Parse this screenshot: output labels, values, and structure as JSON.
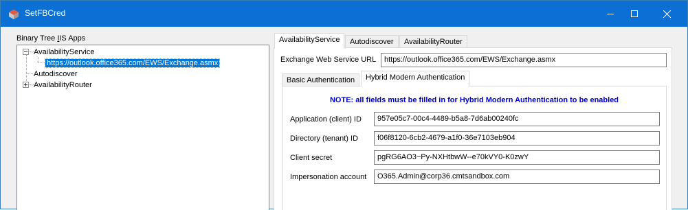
{
  "window": {
    "title": "SetFBCred",
    "accent": "#0b6fd3",
    "controls": {
      "minimize": "minimize-icon",
      "maximize": "maximize-icon",
      "close": "close-icon"
    }
  },
  "tree": {
    "label_prefix": "Binary Tree ",
    "label_mnemonic": "I",
    "label_suffix": "IS Apps",
    "nodes": [
      {
        "label": "AvailabilityService",
        "expanded": true
      },
      {
        "label": "https://outlook.office365.com/EWS/Exchange.asmx",
        "selected": true
      },
      {
        "label": "Autodiscover"
      },
      {
        "label": "AvailabilityRouter",
        "expanded": false
      }
    ]
  },
  "tabs": [
    {
      "label": "AvailabilityService",
      "active": true
    },
    {
      "label": "Autodiscover"
    },
    {
      "label": "AvailabilityRouter"
    }
  ],
  "ews": {
    "label": "Exchange Web Service URL",
    "value": "https://outlook.office365.com/EWS/Exchange.asmx"
  },
  "auth_tabs": [
    {
      "label": "Basic Authentication"
    },
    {
      "label": "Hybrid Modern Authentication",
      "active": true
    }
  ],
  "hybrid": {
    "note": "NOTE: all fields must be filled in for Hybrid Modern Authentication to be enabled",
    "note_color": "#0000cc",
    "fields": [
      {
        "label": "Application (client) ID",
        "value": "957e05c7-00c4-4489-b5a8-7d6ab00240fc"
      },
      {
        "label": "Directory (tenant) ID",
        "value": "f06f8120-6cb2-4679-a1f0-36e7103eb904"
      },
      {
        "label": "Client secret",
        "value": "pgRG6AO3~Py-NXHtbwW--e70kVY0-K0zwY"
      },
      {
        "label": "Impersonation account",
        "value": "O365.Admin@corp36.cmtsandbox.com"
      }
    ]
  }
}
